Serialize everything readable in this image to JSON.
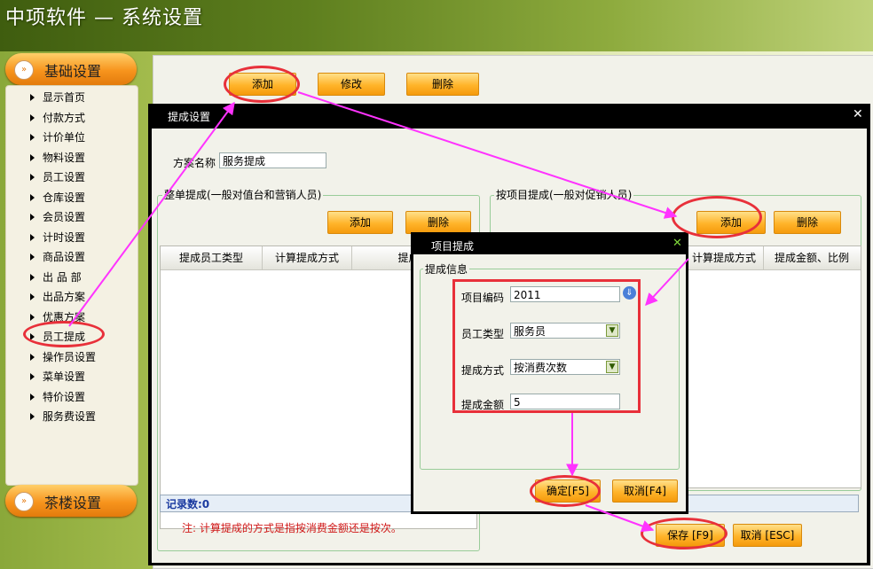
{
  "header": {
    "title": "中项软件 — 系统设置"
  },
  "sidebar": {
    "section_top": "基础设置",
    "section_bottom": "茶楼设置",
    "items": [
      "显示首页",
      "付款方式",
      "计价单位",
      "物料设置",
      "员工设置",
      "仓库设置",
      "会员设置",
      "计时设置",
      "商品设置",
      "出 品 部",
      "出品方案",
      "优惠方案",
      "员工提成",
      "操作员设置",
      "菜单设置",
      "特价设置",
      "服务费设置"
    ]
  },
  "toolbar": {
    "add": "添加",
    "edit": "修改",
    "delete": "删除"
  },
  "commission_dialog": {
    "title": "提成设置",
    "plan_name_label": "方案名称",
    "plan_name_value": "服务提成",
    "left_group": {
      "label": "整单提成(一般对值台和营销人员)",
      "add": "添加",
      "delete": "删除",
      "columns": [
        "提成员工类型",
        "计算提成方式",
        "提成金"
      ],
      "record_count": "记录数:0"
    },
    "right_group": {
      "label": "按项目提成(一般对促销人员)",
      "add": "添加",
      "delete": "删除",
      "columns": [
        "计算提成方式",
        "提成金额、比例"
      ]
    },
    "note": "注: 计算提成的方式是指按消费金额还是按次。",
    "save": "保存 [F9]",
    "cancel": "取消 [ESC]"
  },
  "item_dialog": {
    "title": "项目提成",
    "group_label": "提成信息",
    "fields": {
      "code_label": "项目编码",
      "code_value": "2011",
      "emp_type_label": "员工类型",
      "emp_type_value": "服务员",
      "method_label": "提成方式",
      "method_value": "按消费次数",
      "amount_label": "提成金额",
      "amount_value": "5"
    },
    "ok": "确定[F5]",
    "cancel": "取消[F4]"
  },
  "colors": {
    "annotation_red": "#e8303a",
    "arrow_magenta": "#ff33ff",
    "button_orange": "#ffb42a"
  }
}
